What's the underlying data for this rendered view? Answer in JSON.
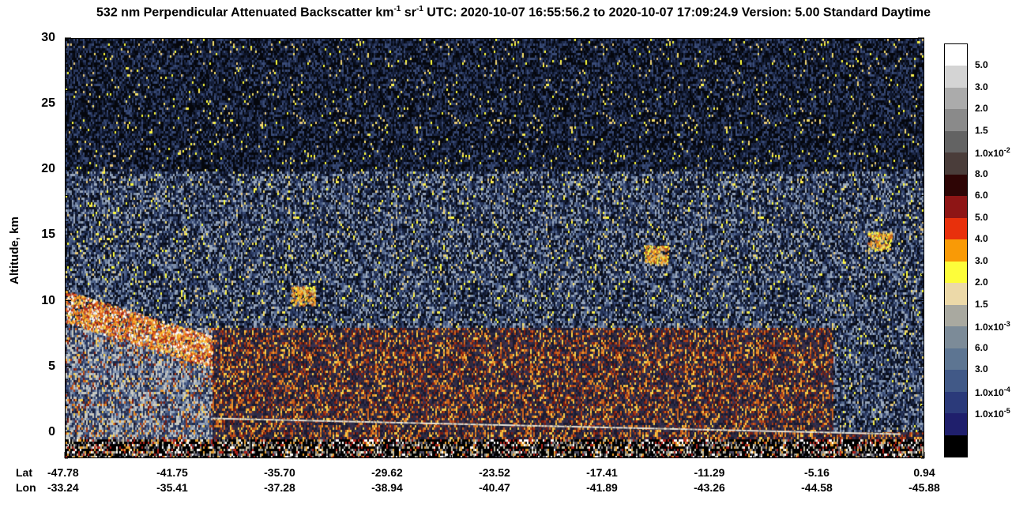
{
  "title": {
    "prefix": "532 nm Perpendicular Attenuated Backscatter km",
    "exp1": "-1",
    "mid": " sr",
    "exp2": "-1",
    "suffix": "  UTC: 2020-10-07 16:55:56.2 to 2020-10-07 17:09:24.9  Version: 5.00 Standard Daytime"
  },
  "chart_data": {
    "type": "heatmap",
    "ylabel": "Altitude, km",
    "ylim": [
      -2,
      30
    ],
    "y_ticks": [
      "0",
      "5",
      "10",
      "15",
      "20",
      "25",
      "30"
    ],
    "y_tick_values": [
      0,
      5,
      10,
      15,
      20,
      25,
      30
    ],
    "x_row_labels": [
      "Lat",
      "Lon"
    ],
    "lat_ticks": [
      "-47.78",
      "-41.75",
      "-35.70",
      "-29.62",
      "-23.52",
      "-17.41",
      "-11.29",
      "-5.16",
      "0.94"
    ],
    "lon_ticks": [
      "-33.24",
      "-35.41",
      "-37.28",
      "-38.94",
      "-40.47",
      "-41.89",
      "-43.26",
      "-44.58",
      "-45.88"
    ],
    "colorbar": {
      "colors": [
        "#ffffff",
        "#d4d4d4",
        "#ababab",
        "#8a8a8a",
        "#636363",
        "#4a3d3a",
        "#2e0505",
        "#8e1515",
        "#e8300c",
        "#f99a06",
        "#fdfd3a",
        "#ecd9a8",
        "#a9a9a0",
        "#7c8b98",
        "#5d7592",
        "#415987",
        "#2b3a7a",
        "#1f1f6c",
        "#000000"
      ],
      "labels": [
        {
          "text": "5.0",
          "exp": ""
        },
        {
          "text": "3.0",
          "exp": ""
        },
        {
          "text": "2.0",
          "exp": ""
        },
        {
          "text": "1.5",
          "exp": ""
        },
        {
          "text": "1.0x10",
          "exp": "-2"
        },
        {
          "text": "8.0",
          "exp": ""
        },
        {
          "text": "6.0",
          "exp": ""
        },
        {
          "text": "5.0",
          "exp": ""
        },
        {
          "text": "4.0",
          "exp": ""
        },
        {
          "text": "3.0",
          "exp": ""
        },
        {
          "text": "2.0",
          "exp": ""
        },
        {
          "text": "1.5",
          "exp": ""
        },
        {
          "text": "1.0x10",
          "exp": "-3"
        },
        {
          "text": "6.0",
          "exp": ""
        },
        {
          "text": "3.0",
          "exp": ""
        },
        {
          "text": "1.0x10",
          "exp": "-4"
        },
        {
          "text": "1.0x10",
          "exp": "-5"
        }
      ]
    }
  }
}
